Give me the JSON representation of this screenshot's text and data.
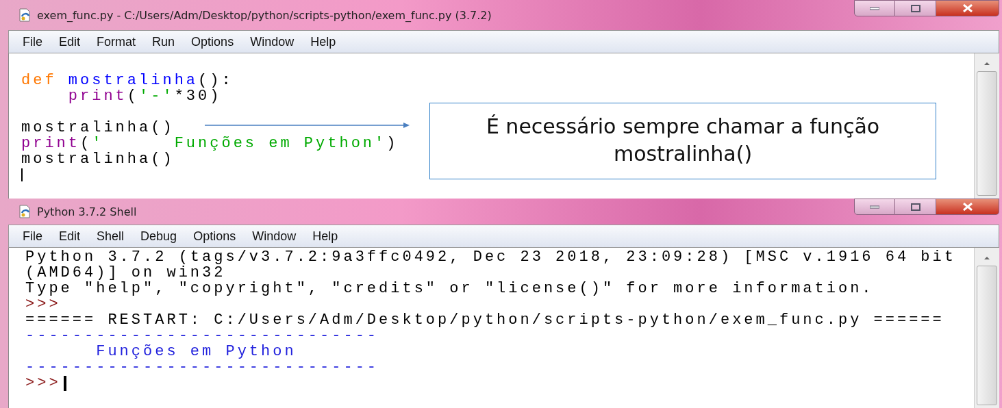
{
  "editor_window": {
    "title": "exem_func.py - C:/Users/Adm/Desktop/python/scripts-python/exem_func.py (3.7.2)",
    "menu": [
      "File",
      "Edit",
      "Format",
      "Run",
      "Options",
      "Window",
      "Help"
    ],
    "code_blocks": [
      [
        [
          {
            "kind": "keyword",
            "text": "def "
          },
          {
            "kind": "definition",
            "text": "mostralinha"
          },
          {
            "kind": "plain",
            "text": "():"
          }
        ],
        [
          {
            "kind": "builtin",
            "text": "    print"
          },
          {
            "kind": "plain",
            "text": "("
          },
          {
            "kind": "string",
            "text": "'-'"
          },
          {
            "kind": "plain",
            "text": "*30)"
          }
        ]
      ],
      [
        [
          {
            "kind": "plain",
            "text": "mostralinha()"
          }
        ],
        [
          {
            "kind": "builtin",
            "text": "print"
          },
          {
            "kind": "plain",
            "text": "("
          },
          {
            "kind": "string",
            "text": "'      Funções em Python'"
          },
          {
            "kind": "plain",
            "text": ")"
          }
        ],
        [
          {
            "kind": "plain",
            "text": "mostralinha()"
          }
        ]
      ]
    ]
  },
  "callout": {
    "text": "É necessário sempre chamar a função mostralinha()"
  },
  "shell_window": {
    "title": "Python 3.7.2 Shell",
    "menu": [
      "File",
      "Edit",
      "Shell",
      "Debug",
      "Options",
      "Window",
      "Help"
    ],
    "lines": [
      {
        "kind": "output",
        "text": "Python 3.7.2 (tags/v3.7.2:9a3ffc0492, Dec 23 2018, 23:09:28) [MSC v.1916 64 bit"
      },
      {
        "kind": "output",
        "text": "(AMD64)] on win32"
      },
      {
        "kind": "output",
        "text": "Type \"help\", \"copyright\", \"credits\" or \"license()\" for more information."
      },
      {
        "kind": "prompt",
        "text": ">>>"
      },
      {
        "kind": "output",
        "text": "====== RESTART: C:/Users/Adm/Desktop/python/scripts-python/exem_func.py ======"
      },
      {
        "kind": "stdout",
        "text": "------------------------------"
      },
      {
        "kind": "stdout",
        "text": "      Funções em Python"
      },
      {
        "kind": "stdout",
        "text": "------------------------------"
      },
      {
        "kind": "prompt",
        "text": ">>>"
      }
    ]
  }
}
